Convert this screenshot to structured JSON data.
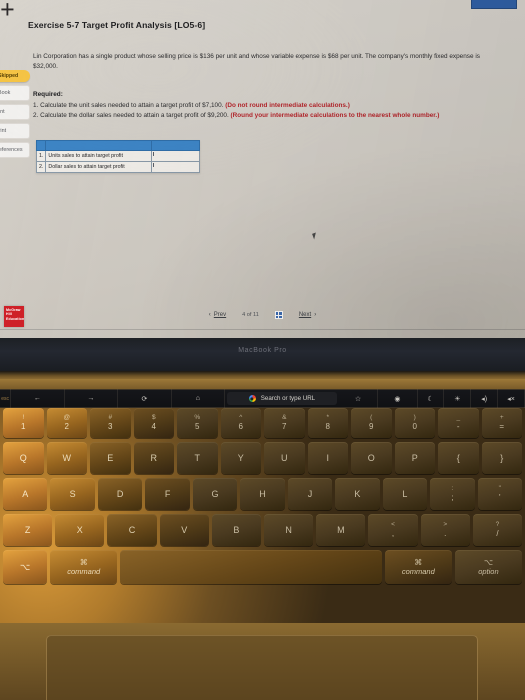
{
  "screen": {
    "exercise_title": "Exercise 5-7 Target Profit Analysis [LO5-6]",
    "problem_text": "Lin Corporation has a single product whose selling price is $136 per unit and whose variable expense is $68 per unit. The company's monthly fixed expense is $32,000.",
    "required_heading": "Required:",
    "requirement_1_main": "1. Calculate the unit sales needed to attain a target profit of $7,100. ",
    "requirement_1_note": "(Do not round intermediate calculations.)",
    "requirement_2_main": "2. Calculate the dollar sales needed to attain a target profit of $9,200. ",
    "requirement_2_note": "(Round your intermediate calculations to the nearest whole number.)",
    "corner_mark": "+",
    "logo_text": "McGraw Hill Education"
  },
  "sidebar": {
    "skipped_pill": "Skipped",
    "items": [
      {
        "label": "eBook"
      },
      {
        "label": "Hint"
      },
      {
        "label": "Print"
      },
      {
        "label": "References"
      }
    ]
  },
  "answer_table": {
    "rows": [
      {
        "num": "1.",
        "label": "Units sales to attain target profit",
        "value": ""
      },
      {
        "num": "2.",
        "label": "Dollar sales to attain target profit",
        "value": ""
      }
    ]
  },
  "pager": {
    "prev_label": "Prev",
    "page_indicator": "4 of 11",
    "next_label": "Next",
    "prev_chevron": "‹",
    "next_chevron": "›"
  },
  "bezel": {
    "brand": "MacBook Pro"
  },
  "touchbar": {
    "esc": "esc",
    "back_icon": "←",
    "forward_icon": "→",
    "reload_icon": "⟳",
    "home_icon": "⌂",
    "url_placeholder": "Search or type URL",
    "bookmark_icon": "☆",
    "privacy_icon": "◉",
    "nightshift_icon": "☾",
    "brightness_icon": "☀",
    "volume_icon": "◂)",
    "mute_icon": "◂×"
  },
  "keyboard": {
    "row_numbers": [
      {
        "top": "!",
        "bot": "1"
      },
      {
        "top": "@",
        "bot": "2"
      },
      {
        "top": "#",
        "bot": "3"
      },
      {
        "top": "$",
        "bot": "4"
      },
      {
        "top": "%",
        "bot": "5"
      },
      {
        "top": "^",
        "bot": "6"
      },
      {
        "top": "&",
        "bot": "7"
      },
      {
        "top": "*",
        "bot": "8"
      },
      {
        "top": "(",
        "bot": "9"
      },
      {
        "top": ")",
        "bot": "0"
      },
      {
        "top": "_",
        "bot": "-"
      },
      {
        "top": "+",
        "bot": "="
      }
    ],
    "row_top": [
      "Q",
      "W",
      "E",
      "R",
      "T",
      "Y",
      "U",
      "I",
      "O",
      "P",
      "{",
      "}"
    ],
    "row_home": [
      {
        "top": "",
        "bot": "A"
      },
      {
        "top": "",
        "bot": "S"
      },
      {
        "top": "",
        "bot": "D"
      },
      {
        "top": "",
        "bot": "F"
      },
      {
        "top": "",
        "bot": "G"
      },
      {
        "top": "",
        "bot": "H"
      },
      {
        "top": "",
        "bot": "J"
      },
      {
        "top": "",
        "bot": "K"
      },
      {
        "top": "",
        "bot": "L"
      },
      {
        "top": ":",
        "bot": ";"
      },
      {
        "top": "\"",
        "bot": "'"
      }
    ],
    "row_bottom_letters": [
      {
        "top": "",
        "bot": "Z"
      },
      {
        "top": "",
        "bot": "X"
      },
      {
        "top": "",
        "bot": "C"
      },
      {
        "top": "",
        "bot": "V"
      },
      {
        "top": "",
        "bot": "B"
      },
      {
        "top": "",
        "bot": "N"
      },
      {
        "top": "",
        "bot": "M"
      },
      {
        "top": "<",
        "bot": ","
      },
      {
        "top": ">",
        "bot": "."
      },
      {
        "top": "?",
        "bot": "/"
      }
    ],
    "modifier_row": {
      "option_left_sym": "⌥",
      "command_left_sym": "⌘",
      "command_left_label": "command",
      "space": "",
      "command_right_sym": "⌘",
      "command_right_label": "command",
      "option_right_sym": "⌥",
      "option_right_label": "option"
    }
  },
  "colors": {
    "table_header_blue": "#3d85c6",
    "required_red": "#b4262c",
    "skipped_yellow": "#f5c445",
    "logo_red": "#d02027"
  }
}
